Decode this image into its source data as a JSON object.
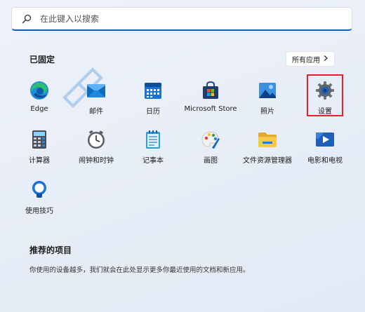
{
  "search": {
    "placeholder": "在此键入以搜索"
  },
  "pinned": {
    "title": "已固定",
    "all_apps_label": "所有应用",
    "apps": [
      {
        "label": "Edge",
        "icon": "edge-icon"
      },
      {
        "label": "邮件",
        "icon": "mail-icon"
      },
      {
        "label": "日历",
        "icon": "calendar-icon"
      },
      {
        "label": "Microsoft Store",
        "icon": "store-icon"
      },
      {
        "label": "照片",
        "icon": "photos-icon"
      },
      {
        "label": "设置",
        "icon": "gear-icon"
      },
      {
        "label": "计算器",
        "icon": "calculator-icon"
      },
      {
        "label": "闹钟和时钟",
        "icon": "clock-icon"
      },
      {
        "label": "记事本",
        "icon": "notepad-icon"
      },
      {
        "label": "画图",
        "icon": "paint-icon"
      },
      {
        "label": "文件资源管理器",
        "icon": "folder-icon"
      },
      {
        "label": "电影和电视",
        "icon": "movies-icon"
      },
      {
        "label": "使用技巧",
        "icon": "tips-icon"
      }
    ]
  },
  "recommended": {
    "title": "推荐的项目",
    "text": "你使用的设备越多，我们就会在此处显示更多你最近使用的文档和新应用。"
  },
  "colors": {
    "accent": "#0a5fc4",
    "highlight": "#e4212b"
  }
}
